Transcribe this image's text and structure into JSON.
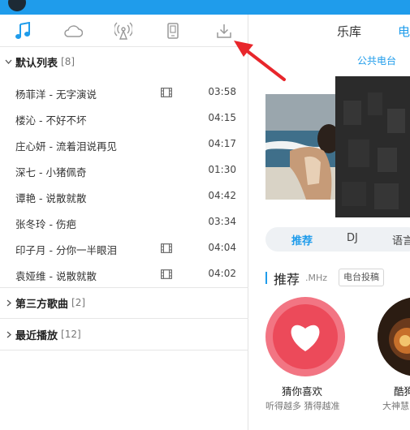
{
  "left_panel": {
    "icon_tabs": [
      {
        "icon": "music-note-icon",
        "active": true
      },
      {
        "icon": "cloud-icon",
        "active": false
      },
      {
        "icon": "radio-antenna-icon",
        "active": false
      },
      {
        "icon": "device-icon",
        "active": false
      },
      {
        "icon": "download-icon",
        "active": false
      }
    ],
    "groups": {
      "default": {
        "name": "默认列表",
        "count": "[8]"
      },
      "third_party": {
        "name": "第三方歌曲",
        "count": "[2]"
      },
      "recent": {
        "name": "最近播放",
        "count": "[12]"
      }
    },
    "tracks": [
      {
        "title": "杨菲洋 - 无字演说",
        "duration": "03:58",
        "has_mv": true
      },
      {
        "title": "楼沁 - 不好不坏",
        "duration": "04:15",
        "has_mv": false
      },
      {
        "title": "庄心妍 - 流着泪说再见",
        "duration": "04:17",
        "has_mv": false
      },
      {
        "title": "深七 - 小猪佩奇",
        "duration": "01:30",
        "has_mv": false
      },
      {
        "title": "谭艳 - 说散就散",
        "duration": "04:42",
        "has_mv": false
      },
      {
        "title": "张冬玲 - 伤疤",
        "duration": "03:34",
        "has_mv": false
      },
      {
        "title": "印子月 - 分你一半眼泪",
        "duration": "04:04",
        "has_mv": true
      },
      {
        "title": "袁娅维 - 说散就散",
        "duration": "04:02",
        "has_mv": true
      }
    ]
  },
  "right_panel": {
    "tabs": [
      "乐库",
      "电"
    ],
    "sublink": "公共电台",
    "pills": [
      "推荐",
      "DJ",
      "语言"
    ],
    "section": {
      "title": "推荐",
      "unit": ".MHz",
      "button": "电台投稿"
    },
    "recommend": [
      {
        "name": "猜你喜欢",
        "desc": "听得越多 猜得越准"
      },
      {
        "name": "酷狗",
        "desc": "大神慧"
      }
    ]
  },
  "colors": {
    "accent": "#1f9ceb",
    "heart_red": "#ec4a5a",
    "annotation_red": "#e8262b"
  }
}
